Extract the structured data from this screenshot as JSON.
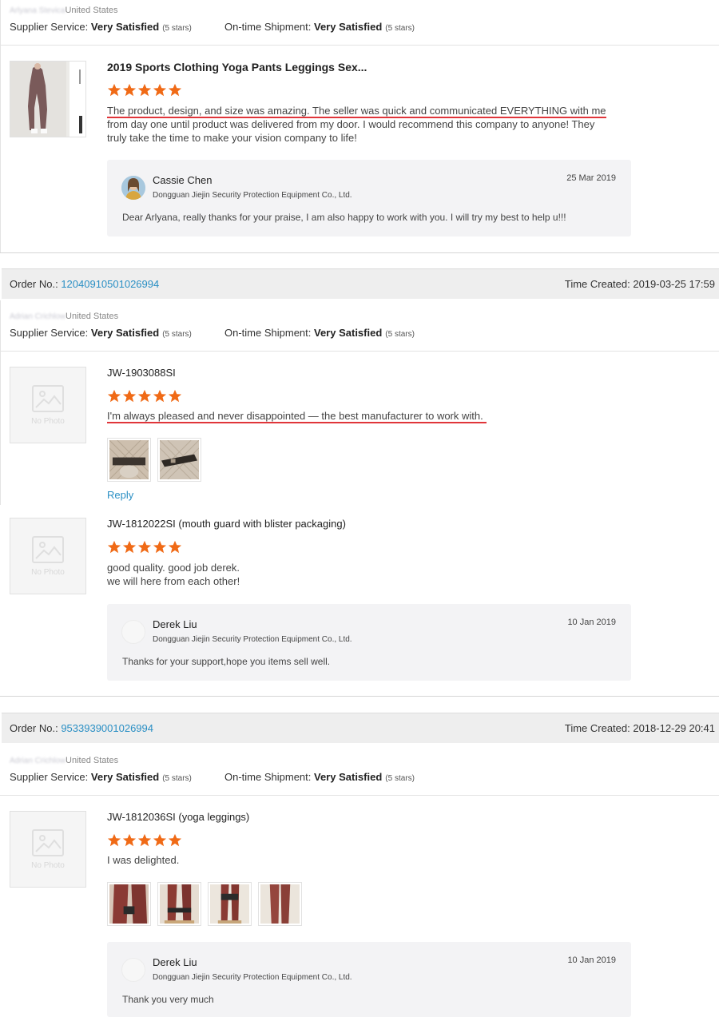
{
  "colors": {
    "accent_link": "#2a8fc4",
    "star": "#f06a16",
    "underline": "#e0353a"
  },
  "orders": [
    {
      "buyer_country": "United States",
      "buyer_name_blurred": "Arlyana Stevica",
      "supplier_service_label": "Supplier Service:",
      "supplier_service_value": "Very Satisfied",
      "supplier_service_stars": "(5 stars)",
      "shipment_label": "On-time Shipment:",
      "shipment_value": "Very Satisfied",
      "shipment_stars": "(5 stars)",
      "items": [
        {
          "title": "2019 Sports Clothing Yoga Pants Leggings Sex...",
          "rating": 5,
          "review_line1": "The product, design, and size was amazing. The seller was quick and communicated EVERYTHING with me",
          "review_line2": "from day one until product was delivered from my door. I would recommend this company to anyone! They",
          "review_line3": "truly take the time to make your vision company to life!",
          "reply": {
            "name": "Cassie Chen",
            "company": "Dongguan Jiejin Security Protection Equipment Co., Ltd.",
            "date": "25 Mar 2019",
            "text": "Dear Arlyana, really thanks for your praise, I am also happy to work with you. I will try my best to help u!!!"
          }
        }
      ]
    },
    {
      "order_label": "Order No.:",
      "order_no": "12040910501026994",
      "time_created": "Time Created: 2019-03-25 17:59",
      "buyer_country": "United States",
      "buyer_name_blurred": "Adrian Crichlow",
      "supplier_service_label": "Supplier Service:",
      "supplier_service_value": "Very Satisfied",
      "supplier_service_stars": "(5 stars)",
      "shipment_label": "On-time Shipment:",
      "shipment_value": "Very Satisfied",
      "shipment_stars": "(5 stars)",
      "no_photo_text": "No Photo",
      "items": [
        {
          "title": "JW-1903088SI",
          "rating": 5,
          "review_line1": "I'm always pleased and never disappointed — the best manufacturer to work with.",
          "reply_link": "Reply"
        },
        {
          "title": "JW-1812022SI (mouth guard with blister packaging)",
          "rating": 5,
          "review_line1": "good quality. good job derek.",
          "review_line2": "we will here from each other!",
          "reply": {
            "name": "Derek Liu",
            "company": "Dongguan Jiejin Security Protection Equipment Co., Ltd.",
            "date": "10 Jan 2019",
            "text": "Thanks for your support,hope you items sell well."
          }
        }
      ]
    },
    {
      "order_label": "Order No.:",
      "order_no": "9533939001026994",
      "time_created": "Time Created: 2018-12-29 20:41",
      "buyer_country": "United States",
      "buyer_name_blurred": "Adrian Crichlow",
      "supplier_service_label": "Supplier Service:",
      "supplier_service_value": "Very Satisfied",
      "supplier_service_stars": "(5 stars)",
      "shipment_label": "On-time Shipment:",
      "shipment_value": "Very Satisfied",
      "shipment_stars": "(5 stars)",
      "no_photo_text": "No Photo",
      "items": [
        {
          "title": "JW-1812036SI (yoga leggings)",
          "rating": 5,
          "review_line1": "I was delighted.",
          "reply": {
            "name": "Derek Liu",
            "company": "Dongguan Jiejin Security Protection Equipment Co., Ltd.",
            "date": "10 Jan 2019",
            "text": "Thank you very much"
          }
        }
      ]
    }
  ]
}
